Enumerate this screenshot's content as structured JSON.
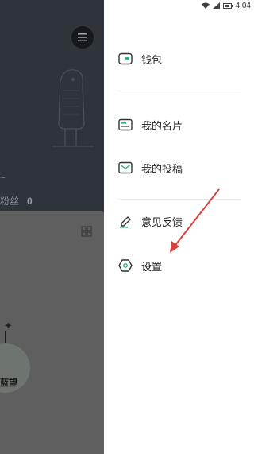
{
  "status_bar": {
    "time": "4:04"
  },
  "background": {
    "tilde": "~",
    "fans_label": "粉丝",
    "fans_count": "0",
    "bubble_label": "蓝望"
  },
  "drawer": {
    "items": [
      {
        "label": "钱包",
        "icon": "wallet-icon"
      },
      {
        "label": "我的名片",
        "icon": "card-icon"
      },
      {
        "label": "我的投稿",
        "icon": "mail-icon"
      },
      {
        "label": "意见反馈",
        "icon": "pencil-icon"
      },
      {
        "label": "设置",
        "icon": "hexagon-settings-icon"
      }
    ]
  },
  "colors": {
    "accent_green": "#22b38a",
    "annotation_arrow": "#d9413d",
    "overlay_dark": "#2f343b"
  }
}
